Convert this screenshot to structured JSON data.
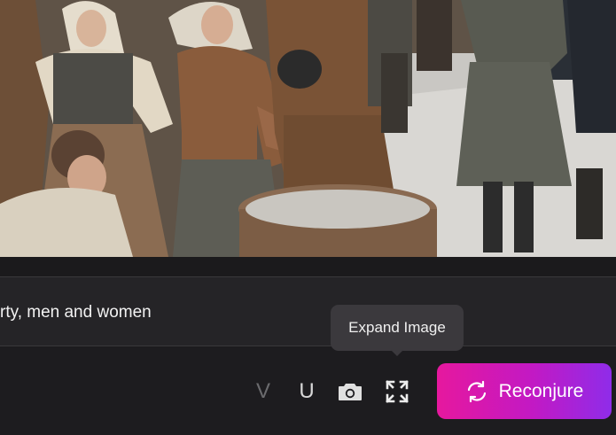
{
  "image": {
    "alt_icon": "generated-image"
  },
  "prompt": {
    "visible_text": "rty, men and women"
  },
  "toolbar": {
    "v_label": "V",
    "u_label": "U",
    "camera_icon": "camera-icon",
    "expand_icon": "expand-icon",
    "tooltip": "Expand Image",
    "reconjure_label": "Reconjure",
    "reconjure_icon": "refresh-icon"
  },
  "colors": {
    "background": "#1c1b1d",
    "prompt_bg": "#252427",
    "tooltip_bg": "#3b393d",
    "accent_start": "#e6189e",
    "accent_end": "#8f2ce9",
    "disabled_text": "#6b6b6e"
  }
}
